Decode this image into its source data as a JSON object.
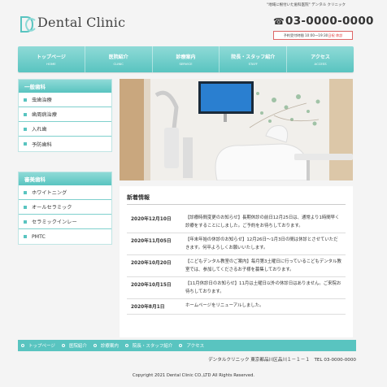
{
  "header": {
    "logo_text": "Dental Clinic",
    "tagline": "\"地域に根付いた歯科医院\" デンタル クリニック",
    "phone": "03-0000-0000",
    "hours_text": "予約受付時間 10:00～19:30 ",
    "hours_closed": "日祝 休診"
  },
  "nav": {
    "items": [
      {
        "jp": "トップページ",
        "en": "HOME"
      },
      {
        "jp": "医院紹介",
        "en": "CLINIC"
      },
      {
        "jp": "診療案内",
        "en": "SERVICE"
      },
      {
        "jp": "院長・スタッフ紹介",
        "en": "STAFF"
      },
      {
        "jp": "アクセス",
        "en": "ACCESS"
      }
    ]
  },
  "sidebar": {
    "general": {
      "title": "一般歯科",
      "items": [
        "虫歯治療",
        "歯周病治療",
        "入れ歯",
        "予防歯科"
      ]
    },
    "cosmetic": {
      "title": "審美歯科",
      "items": [
        "ホワイトニング",
        "オールセラミック",
        "セラミックインレー",
        "PMTC"
      ]
    }
  },
  "news": {
    "title": "新着情報",
    "items": [
      {
        "date": "2020年12月10日",
        "text": "【診療時間変更のお知らせ】長期休診の前日12月25日は、通常より1時間早く診療をすることにしました。ご予約をお待ちしております。"
      },
      {
        "date": "2020年11月05日",
        "text": "【年末年始の休診のお知らせ】12月26日～1月3日の間は休診とさせていただきます。何卒よろしくお願いいたします。"
      },
      {
        "date": "2020年10月20日",
        "text": "【こどもデンタル教室のご案内】毎月第3土曜日に行っているこどもデンタル教室では、参加してくださるお子様を募集しております。"
      },
      {
        "date": "2020年10月15日",
        "text": "【11月休診日のお知らせ】11月は土曜日以外の休診日はありません。ご来院お待ちしております。"
      },
      {
        "date": "2020年8月1日",
        "text": "ホームページをリニューアルしました。"
      }
    ]
  },
  "footer": {
    "nav": [
      "トップページ",
      "医院紹介",
      "診療案内",
      "院長・スタッフ紹介",
      "アクセス"
    ],
    "clinic_info": "デンタルクリニック 東京都品川区品川１－１－１　TEL 03-0000-0000",
    "copyright": "Copyright 2021 Dental Clinic CO.,LTD All Rights Reserved."
  },
  "colors": {
    "accent": "#59c4c0",
    "accent_light": "#8fdad7",
    "closed_red": "#d33"
  },
  "icons": [
    "tooth-logo-icon",
    "phone-icon",
    "square-bullet-icon",
    "circle-bullet-icon"
  ]
}
